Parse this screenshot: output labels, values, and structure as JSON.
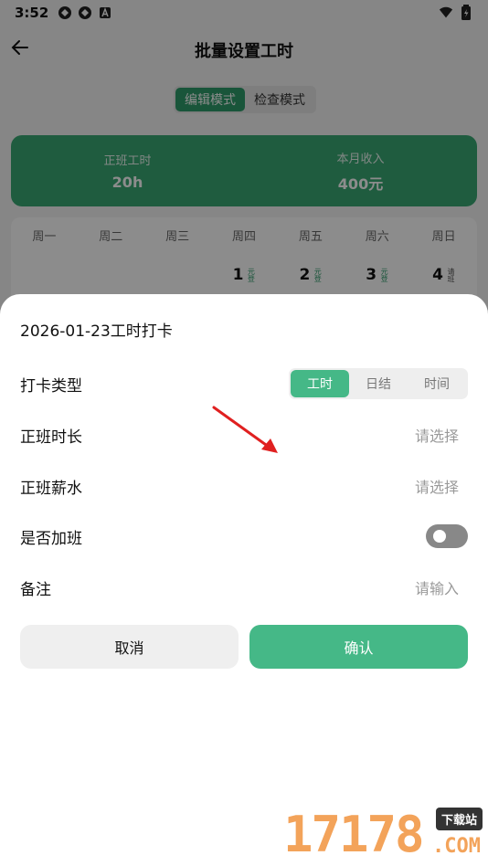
{
  "status_bar": {
    "time": "3:52"
  },
  "header": {
    "title": "批量设置工时"
  },
  "mode_tabs": [
    {
      "label": "编辑模式"
    },
    {
      "label": "检查模式"
    }
  ],
  "summary": [
    {
      "label": "正班工时",
      "value": "20h"
    },
    {
      "label": "本月收入",
      "value": "400元"
    }
  ],
  "calendar": {
    "weekdays": [
      "周一",
      "周二",
      "周三",
      "周四",
      "周五",
      "周六",
      "周日"
    ],
    "days": [
      {
        "num": "",
        "tag": ""
      },
      {
        "num": "",
        "tag": ""
      },
      {
        "num": "",
        "tag": ""
      },
      {
        "num": "1",
        "tag": "元登"
      },
      {
        "num": "2",
        "tag": "元登"
      },
      {
        "num": "3",
        "tag": "元登"
      },
      {
        "num": "4",
        "tag": "请班"
      }
    ]
  },
  "sheet": {
    "title": "2026-01-23工时打卡",
    "punch_type_label": "打卡类型",
    "punch_types": [
      {
        "label": "工时"
      },
      {
        "label": "日结"
      },
      {
        "label": "时间"
      }
    ],
    "regular_hours_label": "正班时长",
    "regular_hours_value": "请选择",
    "regular_pay_label": "正班薪水",
    "regular_pay_value": "请选择",
    "overtime_label": "是否加班",
    "overtime_enabled": false,
    "note_label": "备注",
    "note_placeholder": "请输入",
    "cancel_label": "取消",
    "confirm_label": "确认"
  },
  "watermark": {
    "number": "17178",
    "badge": "下载站",
    "suffix": ".COM"
  },
  "colors": {
    "accent": "#45b887",
    "card": "#3aa874",
    "arrow": "#e02020",
    "watermark": "#f3a35a"
  }
}
